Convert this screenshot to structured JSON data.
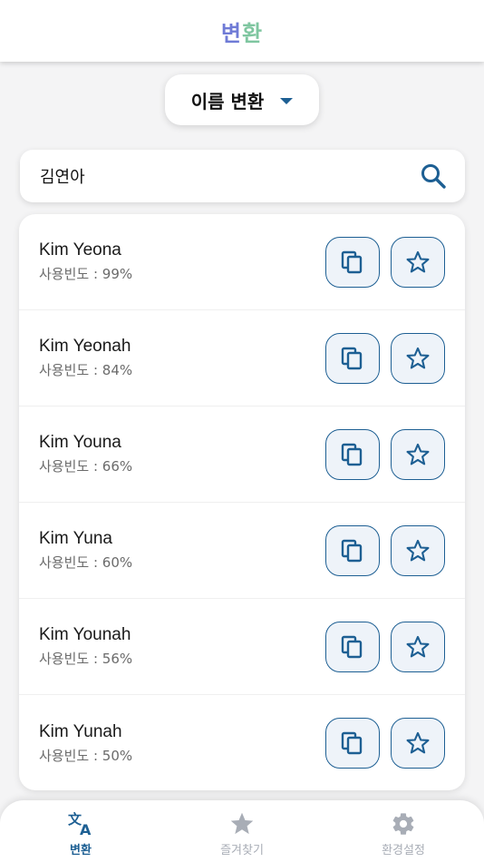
{
  "header": {
    "title_part1": "변",
    "title_part2": "환"
  },
  "mode_select": {
    "selected": "이름 변환"
  },
  "search": {
    "value": "김연아"
  },
  "results": [
    {
      "name": "Kim Yeona",
      "freq": "사용빈도 : 99%"
    },
    {
      "name": "Kim Yeonah",
      "freq": "사용빈도 : 84%"
    },
    {
      "name": "Kim Youna",
      "freq": "사용빈도 : 66%"
    },
    {
      "name": "Kim Yuna",
      "freq": "사용빈도 : 60%"
    },
    {
      "name": "Kim Younah",
      "freq": "사용빈도 : 56%"
    },
    {
      "name": "Kim Yunah",
      "freq": "사용빈도 : 50%"
    }
  ],
  "nav": {
    "convert": "변환",
    "favorites": "즐겨찾기",
    "settings": "환경설정"
  },
  "colors": {
    "accent": "#1d5f93",
    "inactive": "#a8adb6"
  },
  "icons": [
    "search-icon",
    "copy-icon",
    "star-icon",
    "translate-icon",
    "gear-icon",
    "chevron-down-icon"
  ]
}
